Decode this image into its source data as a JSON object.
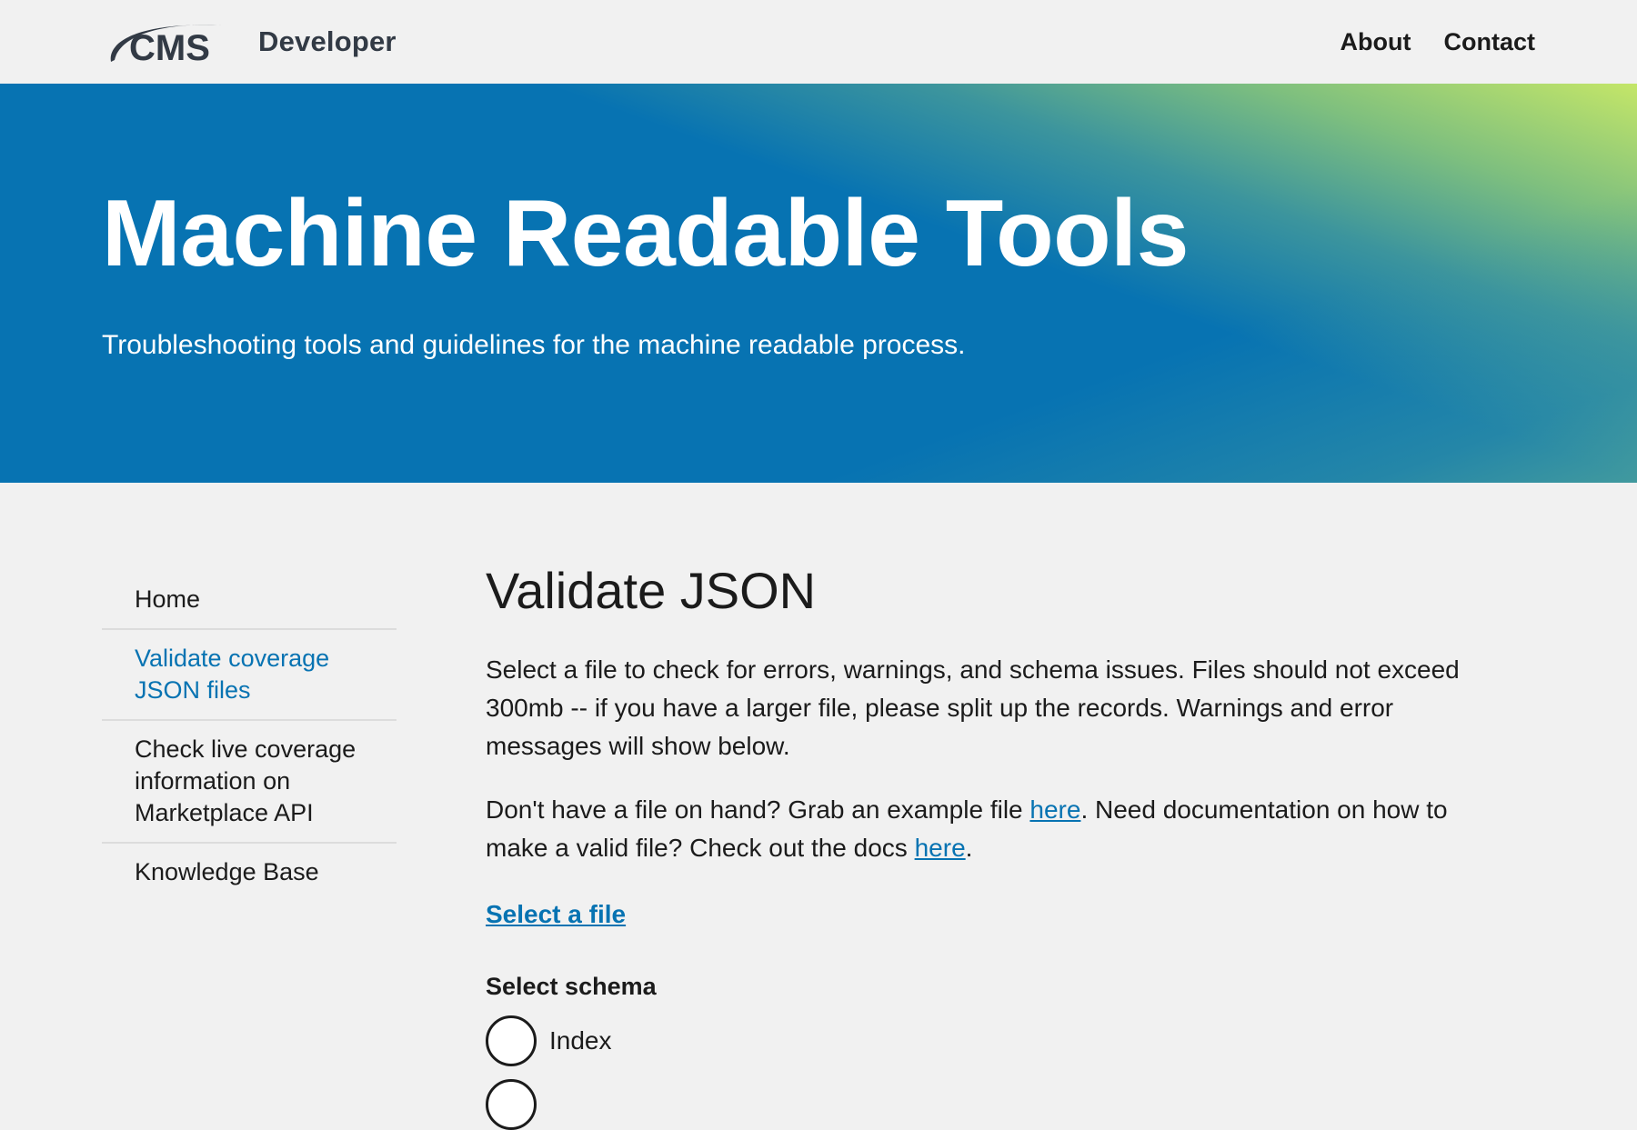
{
  "header": {
    "logo_text": "CMS",
    "brand_suffix": "Developer",
    "nav": [
      {
        "label": "About"
      },
      {
        "label": "Contact"
      }
    ]
  },
  "hero": {
    "title": "Machine Readable Tools",
    "subtitle": "Troubleshooting tools and guidelines for the machine readable process.",
    "colors": {
      "primary": "#0773b2",
      "accent": "#c4e668"
    }
  },
  "sidebar": {
    "items": [
      {
        "label": "Home",
        "current": false
      },
      {
        "label": "Validate coverage JSON files",
        "current": true
      },
      {
        "label": "Check live coverage information on Marketplace API",
        "current": false
      },
      {
        "label": "Knowledge Base",
        "current": false
      }
    ]
  },
  "main": {
    "title": "Validate JSON",
    "intro": "Select a file to check for errors, warnings, and schema issues. Files should not exceed 300mb -- if you have a larger file, please split up the records. Warnings and error messages will show below.",
    "example": {
      "before": "Don't have a file on hand? Grab an example file ",
      "link1": "here",
      "middle": ". Need documentation on how to make a valid file? Check out the docs ",
      "link2": "here",
      "after": "."
    },
    "select_file": "Select a file",
    "schema": {
      "legend": "Select schema",
      "options": [
        {
          "label": "Index",
          "selected": false
        },
        {
          "label": "",
          "selected": false
        }
      ]
    }
  },
  "colors": {
    "link": "#0773b2",
    "background": "#f1f1f1"
  }
}
